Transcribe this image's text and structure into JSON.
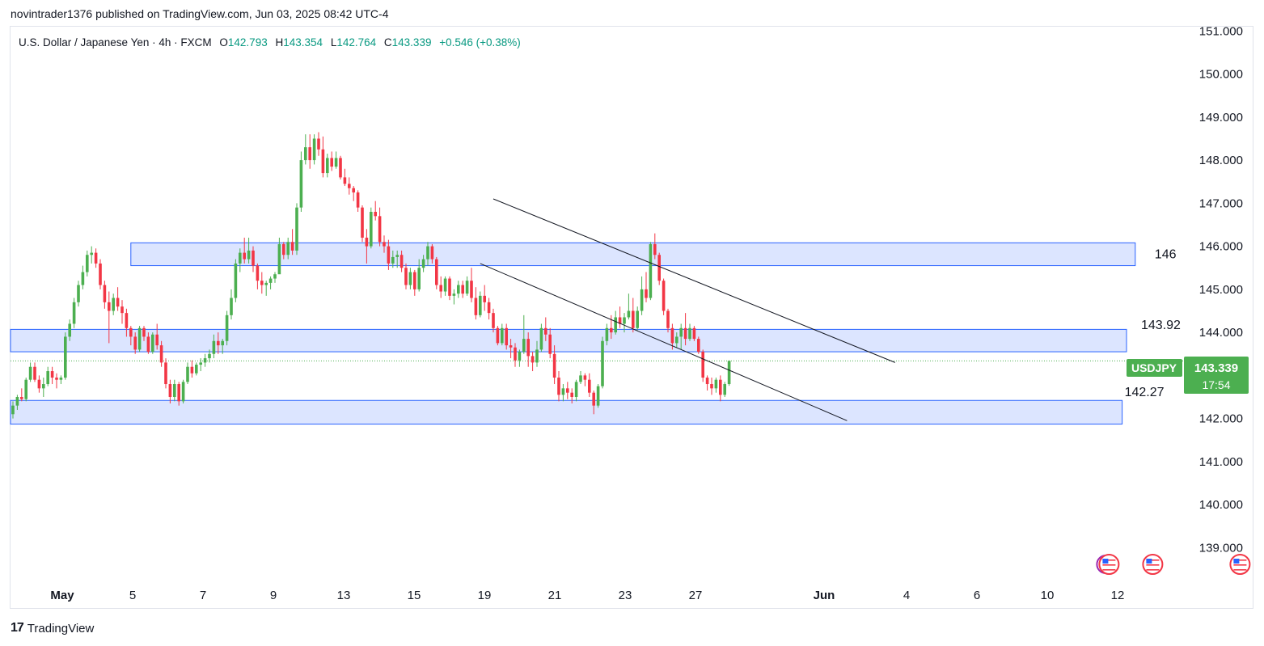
{
  "header": {
    "published": "novintrader1376 published on TradingView.com, Jun 03, 2025 08:42 UTC-4"
  },
  "legend": {
    "symbol": "U.S. Dollar / Japanese Yen · 4h · FXCM",
    "o_label": "O",
    "o": "142.793",
    "h_label": "H",
    "h": "143.354",
    "l_label": "L",
    "l": "142.764",
    "c_label": "C",
    "c": "143.339",
    "change": "+0.546 (+0.38%)"
  },
  "price_tag": {
    "symbol": "USDJPY",
    "price": "143.339",
    "countdown": "17:54"
  },
  "colors": {
    "up": "#089981",
    "up_candle": "#4caf50",
    "down": "#f23645",
    "zone_fill": "#d6e0ff",
    "zone_border": "#2962ff",
    "last_price": "#4caf50"
  },
  "footer": {
    "logo_mark": "17",
    "logo_text": "TradingView"
  },
  "chart_data": {
    "type": "candlestick",
    "interval": "4h",
    "ylim": [
      138.2,
      151.1
    ],
    "y_ticks": [
      139,
      140,
      141,
      142,
      143,
      144,
      145,
      146,
      147,
      148,
      149,
      150,
      151
    ],
    "y_tick_labels": [
      "139.000",
      "140.000",
      "141.000",
      "142.000",
      "143.000",
      "144.000",
      "145.000",
      "146.000",
      "147.000",
      "148.000",
      "149.000",
      "150.000",
      "151.000"
    ],
    "x_tick_labels": [
      "May",
      "5",
      "7",
      "9",
      "13",
      "15",
      "19",
      "21",
      "23",
      "27",
      "Jun",
      "4",
      "6",
      "10",
      "12"
    ],
    "x_tick_bold": [
      "May",
      "Jun"
    ],
    "grid": false,
    "last_price": 143.339,
    "zones": [
      {
        "label": "146",
        "top": 146.08,
        "bottom": 145.55,
        "from_bar": 27,
        "to_bar": 257
      },
      {
        "label": "143.92",
        "top": 144.07,
        "bottom": 143.55,
        "from_bar": 0,
        "to_bar": 255
      },
      {
        "label": "142.27",
        "top": 142.42,
        "bottom": 141.87,
        "from_bar": 0,
        "to_bar": 254
      }
    ],
    "trendlines": [
      {
        "from_bar": 110,
        "from_price": 147.1,
        "to_bar": 202,
        "to_price": 143.3
      },
      {
        "from_bar": 107,
        "from_price": 145.6,
        "to_bar": 191,
        "to_price": 141.95
      }
    ],
    "event_markers": [
      {
        "bar": 251,
        "count": 2
      },
      {
        "bar": 261,
        "count": 1
      },
      {
        "bar": 281,
        "count": 1
      }
    ],
    "candles": [
      [
        142.1,
        142.4,
        142.0,
        142.3
      ],
      [
        142.3,
        142.55,
        142.2,
        142.5
      ],
      [
        142.5,
        142.7,
        142.4,
        142.45
      ],
      [
        142.45,
        142.95,
        142.4,
        142.9
      ],
      [
        142.9,
        143.3,
        142.85,
        143.2
      ],
      [
        143.2,
        143.3,
        142.85,
        142.9
      ],
      [
        142.9,
        143.0,
        142.6,
        142.7
      ],
      [
        142.7,
        142.95,
        142.5,
        142.8
      ],
      [
        142.8,
        143.2,
        142.75,
        143.1
      ],
      [
        143.1,
        143.2,
        142.8,
        142.95
      ],
      [
        142.95,
        143.05,
        142.7,
        142.9
      ],
      [
        142.9,
        143.0,
        142.8,
        142.95
      ],
      [
        142.95,
        144.0,
        142.9,
        143.9
      ],
      [
        143.9,
        144.3,
        143.8,
        144.2
      ],
      [
        144.2,
        144.8,
        144.1,
        144.7
      ],
      [
        144.7,
        145.2,
        144.6,
        145.1
      ],
      [
        145.1,
        145.55,
        145.0,
        145.4
      ],
      [
        145.4,
        145.9,
        145.3,
        145.8
      ],
      [
        145.8,
        146.0,
        145.6,
        145.85
      ],
      [
        145.85,
        145.95,
        145.5,
        145.6
      ],
      [
        145.6,
        145.7,
        145.0,
        145.1
      ],
      [
        145.1,
        145.2,
        144.55,
        144.7
      ],
      [
        144.7,
        144.95,
        143.75,
        144.5
      ],
      [
        144.5,
        144.9,
        144.4,
        144.8
      ],
      [
        144.8,
        145.05,
        144.5,
        144.6
      ],
      [
        144.6,
        144.75,
        144.2,
        144.45
      ],
      [
        144.45,
        144.55,
        143.9,
        144.1
      ],
      [
        144.1,
        144.15,
        143.7,
        143.9
      ],
      [
        143.9,
        144.0,
        143.5,
        143.6
      ],
      [
        143.6,
        144.15,
        143.55,
        144.1
      ],
      [
        144.1,
        144.15,
        143.8,
        143.9
      ],
      [
        143.9,
        144.0,
        143.5,
        143.55
      ],
      [
        143.55,
        144.0,
        143.5,
        143.95
      ],
      [
        143.95,
        144.2,
        143.6,
        143.7
      ],
      [
        143.7,
        143.8,
        143.2,
        143.3
      ],
      [
        143.3,
        143.4,
        142.7,
        142.8
      ],
      [
        142.8,
        142.9,
        142.35,
        142.5
      ],
      [
        142.5,
        142.9,
        142.4,
        142.8
      ],
      [
        142.8,
        142.85,
        142.3,
        142.4
      ],
      [
        142.4,
        142.9,
        142.35,
        142.85
      ],
      [
        142.85,
        143.3,
        142.8,
        143.2
      ],
      [
        143.2,
        143.35,
        142.95,
        143.05
      ],
      [
        143.05,
        143.3,
        143.0,
        143.25
      ],
      [
        143.25,
        143.4,
        143.1,
        143.3
      ],
      [
        143.3,
        143.5,
        143.2,
        143.4
      ],
      [
        143.4,
        143.6,
        143.3,
        143.5
      ],
      [
        143.5,
        143.95,
        143.4,
        143.8
      ],
      [
        143.8,
        144.0,
        143.5,
        143.7
      ],
      [
        143.7,
        143.85,
        143.5,
        143.8
      ],
      [
        143.8,
        144.5,
        143.7,
        144.4
      ],
      [
        144.4,
        145.0,
        144.3,
        144.8
      ],
      [
        144.8,
        145.7,
        144.7,
        145.6
      ],
      [
        145.6,
        145.95,
        145.4,
        145.85
      ],
      [
        145.85,
        146.2,
        145.6,
        145.7
      ],
      [
        145.7,
        146.2,
        145.6,
        145.9
      ],
      [
        145.9,
        146.0,
        145.4,
        145.55
      ],
      [
        145.55,
        145.6,
        145.0,
        145.2
      ],
      [
        145.2,
        145.4,
        144.9,
        145.1
      ],
      [
        145.1,
        145.2,
        144.85,
        145.15
      ],
      [
        145.15,
        145.3,
        145.0,
        145.25
      ],
      [
        145.25,
        145.4,
        145.15,
        145.35
      ],
      [
        145.35,
        146.2,
        145.7,
        146.05
      ],
      [
        146.05,
        146.1,
        145.7,
        145.8
      ],
      [
        145.8,
        146.2,
        145.7,
        146.1
      ],
      [
        146.1,
        146.4,
        145.8,
        145.9
      ],
      [
        145.9,
        147.0,
        145.8,
        146.9
      ],
      [
        146.9,
        148.2,
        146.8,
        148.0
      ],
      [
        148.0,
        148.6,
        147.9,
        148.3
      ],
      [
        148.3,
        148.6,
        147.8,
        148.0
      ],
      [
        148.0,
        148.6,
        147.9,
        148.5
      ],
      [
        148.5,
        148.65,
        148.1,
        148.25
      ],
      [
        148.25,
        148.55,
        147.6,
        147.7
      ],
      [
        147.7,
        148.15,
        147.6,
        148.05
      ],
      [
        148.05,
        148.2,
        147.75,
        147.85
      ],
      [
        147.85,
        148.2,
        147.8,
        148.05
      ],
      [
        148.05,
        148.1,
        147.55,
        147.6
      ],
      [
        147.6,
        147.8,
        147.4,
        147.45
      ],
      [
        147.45,
        147.6,
        147.2,
        147.35
      ],
      [
        147.35,
        147.4,
        147.05,
        147.25
      ],
      [
        147.25,
        147.3,
        146.8,
        146.9
      ],
      [
        146.9,
        146.95,
        146.1,
        146.2
      ],
      [
        146.2,
        146.4,
        145.6,
        146.0
      ],
      [
        146.0,
        146.9,
        145.95,
        146.8
      ],
      [
        146.8,
        147.05,
        146.6,
        146.7
      ],
      [
        146.7,
        146.9,
        146.0,
        146.1
      ],
      [
        146.1,
        146.25,
        145.85,
        146.0
      ],
      [
        146.0,
        146.15,
        145.45,
        145.6
      ],
      [
        145.6,
        145.9,
        145.5,
        145.75
      ],
      [
        145.75,
        145.9,
        145.5,
        145.8
      ],
      [
        145.8,
        145.9,
        145.4,
        145.5
      ],
      [
        145.5,
        145.6,
        145.0,
        145.1
      ],
      [
        145.1,
        145.5,
        145.0,
        145.4
      ],
      [
        145.4,
        145.45,
        144.85,
        145.0
      ],
      [
        145.0,
        145.7,
        144.95,
        145.5
      ],
      [
        145.5,
        145.8,
        145.4,
        145.7
      ],
      [
        145.7,
        146.1,
        145.55,
        146.0
      ],
      [
        146.0,
        146.05,
        145.6,
        145.7
      ],
      [
        145.7,
        145.75,
        145.0,
        145.1
      ],
      [
        145.1,
        145.3,
        144.8,
        144.95
      ],
      [
        144.95,
        145.3,
        144.85,
        145.25
      ],
      [
        145.25,
        145.3,
        144.75,
        144.85
      ],
      [
        144.85,
        145.0,
        144.65,
        144.9
      ],
      [
        144.9,
        145.2,
        144.8,
        145.1
      ],
      [
        145.1,
        145.2,
        144.8,
        144.9
      ],
      [
        144.9,
        145.3,
        144.85,
        145.2
      ],
      [
        145.2,
        145.5,
        144.7,
        144.8
      ],
      [
        144.8,
        145.05,
        144.3,
        144.4
      ],
      [
        144.4,
        144.95,
        144.35,
        144.85
      ],
      [
        144.85,
        145.1,
        144.5,
        144.7
      ],
      [
        144.7,
        144.8,
        144.3,
        144.45
      ],
      [
        144.45,
        144.55,
        144.0,
        144.1
      ],
      [
        144.1,
        144.15,
        143.7,
        143.75
      ],
      [
        143.75,
        144.2,
        143.7,
        144.1
      ],
      [
        144.1,
        144.2,
        143.6,
        143.7
      ],
      [
        143.7,
        143.85,
        143.4,
        143.65
      ],
      [
        143.65,
        143.75,
        143.2,
        143.35
      ],
      [
        143.35,
        143.6,
        143.2,
        143.55
      ],
      [
        143.55,
        144.4,
        143.5,
        143.85
      ],
      [
        143.85,
        144.0,
        143.2,
        143.45
      ],
      [
        143.45,
        143.55,
        143.1,
        143.3
      ],
      [
        143.3,
        143.8,
        143.2,
        143.6
      ],
      [
        143.6,
        144.2,
        143.55,
        144.1
      ],
      [
        144.1,
        144.35,
        143.8,
        143.95
      ],
      [
        143.95,
        144.1,
        143.4,
        143.5
      ],
      [
        143.5,
        143.7,
        142.8,
        142.95
      ],
      [
        142.95,
        143.1,
        142.4,
        142.55
      ],
      [
        142.55,
        142.8,
        142.4,
        142.7
      ],
      [
        142.7,
        142.85,
        142.45,
        142.6
      ],
      [
        142.6,
        142.7,
        142.35,
        142.5
      ],
      [
        142.5,
        142.9,
        142.4,
        142.85
      ],
      [
        142.85,
        143.1,
        142.8,
        143.0
      ],
      [
        143.0,
        143.05,
        142.75,
        142.9
      ],
      [
        142.9,
        143.05,
        142.5,
        142.6
      ],
      [
        142.6,
        142.65,
        142.1,
        142.3
      ],
      [
        142.3,
        142.8,
        142.25,
        142.75
      ],
      [
        142.75,
        143.9,
        142.7,
        143.8
      ],
      [
        143.8,
        144.2,
        143.7,
        144.1
      ],
      [
        144.1,
        144.4,
        143.85,
        144.0
      ],
      [
        144.0,
        144.5,
        143.95,
        144.35
      ],
      [
        144.35,
        144.6,
        144.1,
        144.2
      ],
      [
        144.2,
        144.45,
        144.0,
        144.35
      ],
      [
        144.35,
        144.9,
        144.3,
        144.5
      ],
      [
        144.5,
        144.8,
        144.0,
        144.1
      ],
      [
        144.1,
        144.6,
        144.05,
        144.5
      ],
      [
        144.5,
        145.3,
        144.4,
        145.0
      ],
      [
        145.0,
        145.4,
        144.7,
        144.8
      ],
      [
        144.8,
        146.1,
        144.75,
        146.05
      ],
      [
        146.05,
        146.3,
        145.7,
        145.8
      ],
      [
        145.8,
        145.85,
        145.1,
        145.2
      ],
      [
        145.2,
        145.25,
        144.4,
        144.5
      ],
      [
        144.5,
        144.55,
        144.0,
        144.1
      ],
      [
        144.1,
        144.2,
        143.6,
        143.75
      ],
      [
        143.75,
        144.0,
        143.65,
        143.9
      ],
      [
        143.9,
        144.2,
        143.6,
        144.1
      ],
      [
        144.1,
        144.45,
        143.7,
        143.85
      ],
      [
        143.85,
        144.2,
        143.8,
        144.1
      ],
      [
        144.1,
        144.15,
        143.8,
        143.85
      ],
      [
        143.85,
        143.9,
        143.5,
        143.55
      ],
      [
        143.55,
        143.6,
        142.85,
        142.95
      ],
      [
        142.95,
        143.0,
        142.65,
        142.8
      ],
      [
        142.8,
        142.95,
        142.55,
        142.7
      ],
      [
        142.7,
        142.95,
        142.6,
        142.9
      ],
      [
        142.9,
        143.0,
        142.4,
        142.55
      ],
      [
        142.55,
        142.85,
        142.5,
        142.8
      ],
      [
        142.8,
        143.35,
        142.76,
        143.339
      ]
    ]
  }
}
